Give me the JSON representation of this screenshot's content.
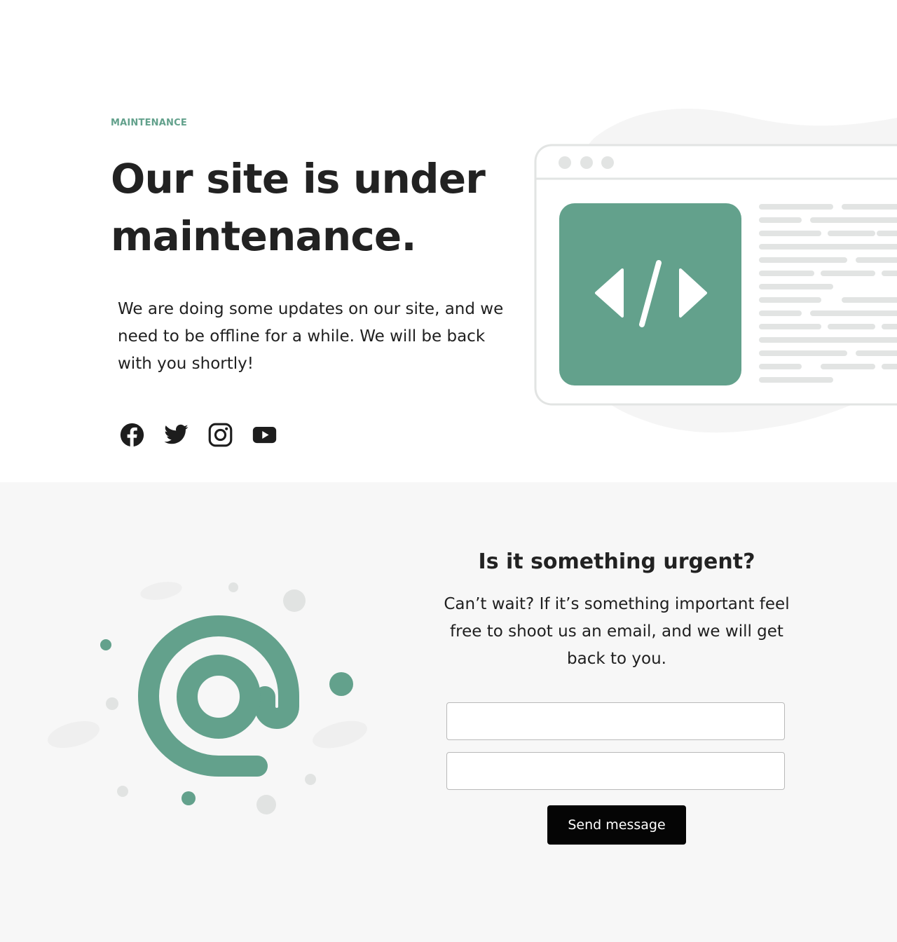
{
  "hero": {
    "eyebrow": "MAINTENANCE",
    "title": "Our site is under maintenance.",
    "description": "We are doing some updates on our site, and we need to be offline for a while. We will be back with you shortly!",
    "socials": [
      {
        "label": "Facebook",
        "icon": "facebook-icon"
      },
      {
        "label": "Twitter",
        "icon": "twitter-icon"
      },
      {
        "label": "Instagram",
        "icon": "instagram-icon"
      },
      {
        "label": "YouTube",
        "icon": "youtube-icon"
      }
    ]
  },
  "contact": {
    "title": "Is it something urgent?",
    "text": "Can’t wait? If it’s something important feel free to shoot us an email, and we will get back to you.",
    "field_one_value": "",
    "field_two_value": "",
    "send_label": "Send message"
  },
  "colors": {
    "accent": "#63a18c",
    "text": "#1f1f1f",
    "button": "#050505",
    "section_bg": "#f7f7f7"
  }
}
